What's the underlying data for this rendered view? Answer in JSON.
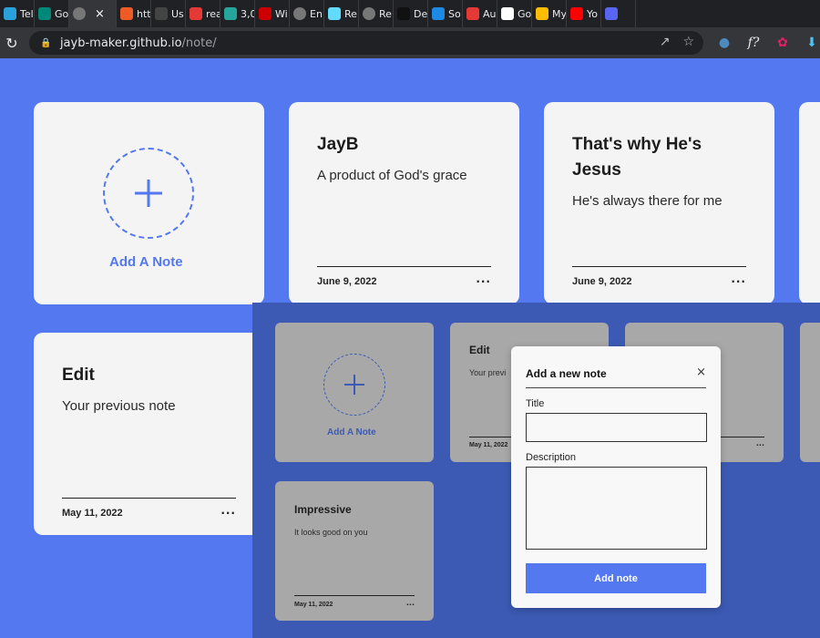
{
  "browser": {
    "tabs": [
      {
        "label": "Tel",
        "icon": "telegram-icon",
        "color": "#2aa1da"
      },
      {
        "label": "Go",
        "icon": "google-meet-icon",
        "color": "#00897b"
      },
      {
        "label": "",
        "icon": "globe-icon",
        "color": "#777777",
        "active": true
      },
      {
        "label": "htt",
        "icon": "postman-icon",
        "color": "#ef5b25"
      },
      {
        "label": "Us",
        "icon": "m-icon",
        "color": "#444444"
      },
      {
        "label": "rea",
        "icon": "readme-icon",
        "color": "#e53935"
      },
      {
        "label": "3,0",
        "icon": "d-icon",
        "color": "#26a69a"
      },
      {
        "label": "Wi",
        "icon": "redhat-icon",
        "color": "#cc0000"
      },
      {
        "label": "En",
        "icon": "globe-icon",
        "color": "#777777"
      },
      {
        "label": "Re",
        "icon": "react-icon",
        "color": "#61dafb"
      },
      {
        "label": "Re",
        "icon": "globe-icon",
        "color": "#777777"
      },
      {
        "label": "De",
        "icon": "medium-icon",
        "color": "#111111"
      },
      {
        "label": "So",
        "icon": "zb-icon",
        "color": "#1e88e5"
      },
      {
        "label": "Au",
        "icon": "asterisk-icon",
        "color": "#e53935"
      },
      {
        "label": "Go",
        "icon": "google-icon",
        "color": "#ffffff"
      },
      {
        "label": "My",
        "icon": "drive-icon",
        "color": "#fbbc04"
      },
      {
        "label": "Yo",
        "icon": "youtube-icon",
        "color": "#ff0000"
      },
      {
        "label": "",
        "icon": "dc-icon",
        "color": "#5865f2"
      }
    ],
    "active_tab_close": "×",
    "url_host": "jayb-maker.github.io",
    "url_path": "/note/"
  },
  "notes": {
    "add_label": "Add A Note",
    "cards": [
      {
        "title": "JayB",
        "description": "A product of God's grace",
        "date": "June 9, 2022",
        "menu": "..."
      },
      {
        "title": "That's why He's Jesus",
        "description": "He's always there for me",
        "date": "June 9, 2022",
        "menu": "..."
      },
      {
        "title": "Edit",
        "description": "Your previous note",
        "date": "May 11, 2022",
        "menu": "..."
      }
    ]
  },
  "overlay": {
    "add_label": "Add A Note",
    "cards": [
      {
        "title": "Edit",
        "description": "Your previ",
        "date": "May 11, 2022",
        "menu": "..."
      },
      {
        "title": "Impressive",
        "description": "It looks good on you",
        "date": "May 11, 2022",
        "menu": "..."
      }
    ],
    "hidden_card_menu": "...",
    "modal": {
      "title": "Add a new note",
      "close": "×",
      "title_label": "Title",
      "description_label": "Description",
      "title_value": "",
      "description_value": "",
      "submit_label": "Add note"
    }
  },
  "colors": {
    "page_bg": "#5478f0",
    "overlay_bg": "#3c5ab4",
    "card_bg": "#f4f4f4",
    "overlay_card_bg": "#a8a8a8",
    "accent": "#5478f0"
  }
}
